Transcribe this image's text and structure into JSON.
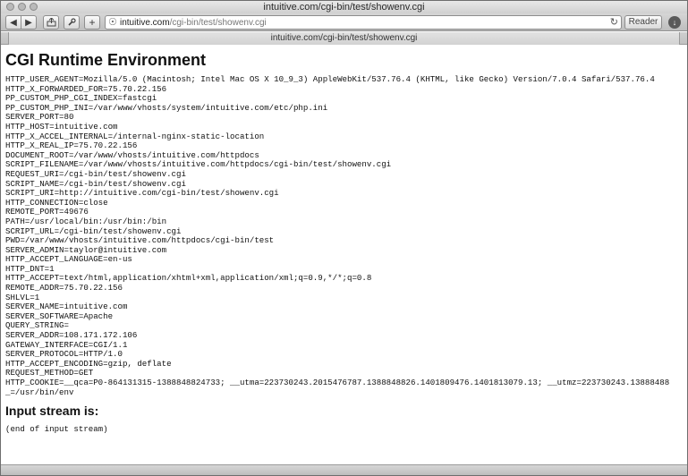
{
  "window": {
    "title": "intuitive.com/cgi-bin/test/showenv.cgi"
  },
  "toolbar": {
    "back_icon": "back-arrow-icon",
    "forward_icon": "forward-arrow-icon",
    "share_icon": "share-icon",
    "settings_icon": "wrench-icon",
    "add_icon": "plus-icon",
    "url_host": "intuitive.com",
    "url_path": "/cgi-bin/test/showenv.cgi",
    "reader_label": "Reader"
  },
  "tab": {
    "label": "intuitive.com/cgi-bin/test/showenv.cgi"
  },
  "page": {
    "title": "CGI Runtime Environment",
    "env_lines": [
      "HTTP_USER_AGENT=Mozilla/5.0 (Macintosh; Intel Mac OS X 10_9_3) AppleWebKit/537.76.4 (KHTML, like Gecko) Version/7.0.4 Safari/537.76.4",
      "HTTP_X_FORWARDED_FOR=75.70.22.156",
      "PP_CUSTOM_PHP_CGI_INDEX=fastcgi",
      "PP_CUSTOM_PHP_INI=/var/www/vhosts/system/intuitive.com/etc/php.ini",
      "SERVER_PORT=80",
      "HTTP_HOST=intuitive.com",
      "HTTP_X_ACCEL_INTERNAL=/internal-nginx-static-location",
      "HTTP_X_REAL_IP=75.70.22.156",
      "DOCUMENT_ROOT=/var/www/vhosts/intuitive.com/httpdocs",
      "SCRIPT_FILENAME=/var/www/vhosts/intuitive.com/httpdocs/cgi-bin/test/showenv.cgi",
      "REQUEST_URI=/cgi-bin/test/showenv.cgi",
      "SCRIPT_NAME=/cgi-bin/test/showenv.cgi",
      "SCRIPT_URI=http://intuitive.com/cgi-bin/test/showenv.cgi",
      "HTTP_CONNECTION=close",
      "REMOTE_PORT=49676",
      "PATH=/usr/local/bin:/usr/bin:/bin",
      "SCRIPT_URL=/cgi-bin/test/showenv.cgi",
      "PWD=/var/www/vhosts/intuitive.com/httpdocs/cgi-bin/test",
      "SERVER_ADMIN=taylor@intuitive.com",
      "HTTP_ACCEPT_LANGUAGE=en-us",
      "HTTP_DNT=1",
      "HTTP_ACCEPT=text/html,application/xhtml+xml,application/xml;q=0.9,*/*;q=0.8",
      "REMOTE_ADDR=75.70.22.156",
      "SHLVL=1",
      "SERVER_NAME=intuitive.com",
      "SERVER_SOFTWARE=Apache",
      "QUERY_STRING=",
      "SERVER_ADDR=108.171.172.106",
      "GATEWAY_INTERFACE=CGI/1.1",
      "SERVER_PROTOCOL=HTTP/1.0",
      "HTTP_ACCEPT_ENCODING=gzip, deflate",
      "REQUEST_METHOD=GET",
      "HTTP_COOKIE=__qca=P0-864131315-1388848824733; __utma=223730243.2015476787.1388848826.1401809476.1401813079.13; __utmz=223730243.13888488",
      "_=/usr/bin/env"
    ],
    "input_heading": "Input stream is:",
    "input_text": "(end of input stream)"
  }
}
